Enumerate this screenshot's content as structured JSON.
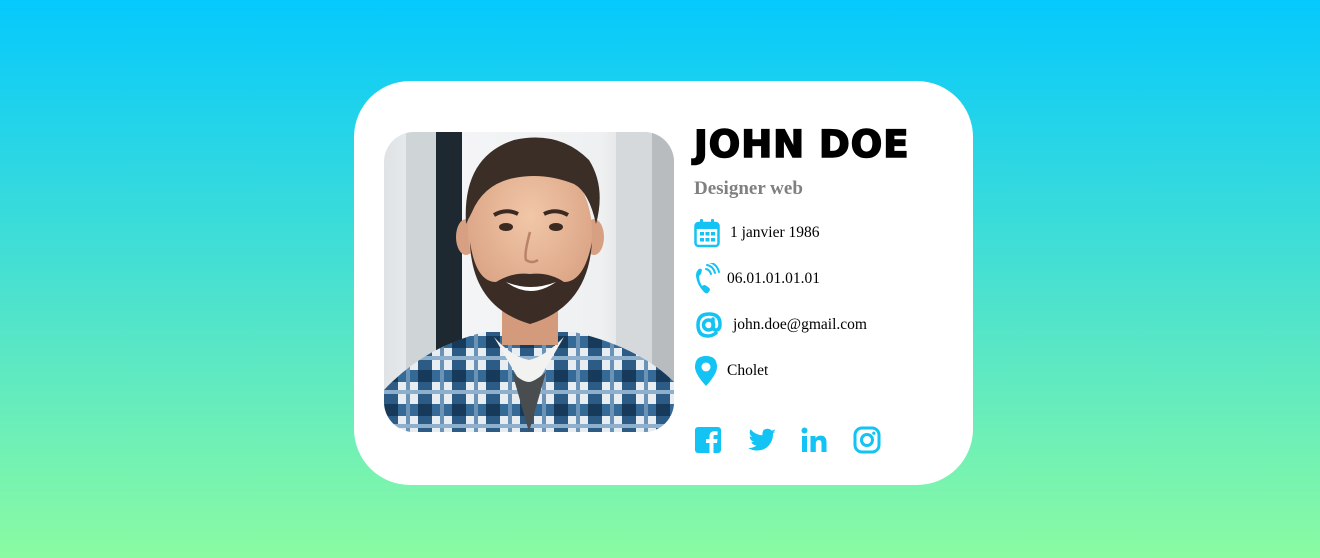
{
  "profile": {
    "name": "JOHN DOE",
    "role": "Designer web",
    "photo_alt": "Portrait of a smiling bearded man in a plaid shirt"
  },
  "details": {
    "birthdate": {
      "icon": "calendar-icon",
      "text": "1 janvier 1986"
    },
    "phone": {
      "icon": "phone-icon",
      "text": "06.01.01.01.01"
    },
    "email": {
      "icon": "at-icon",
      "text": "john.doe@gmail.com"
    },
    "location": {
      "icon": "location-pin-icon",
      "text": "Cholet"
    }
  },
  "socials": [
    {
      "icon": "facebook-icon"
    },
    {
      "icon": "twitter-icon"
    },
    {
      "icon": "linkedin-icon"
    },
    {
      "icon": "instagram-icon"
    }
  ],
  "colors": {
    "accent": "#12c3f4",
    "gradient_top": "#05c9fd",
    "gradient_bottom": "#8bfba2",
    "role_text": "#808080"
  }
}
